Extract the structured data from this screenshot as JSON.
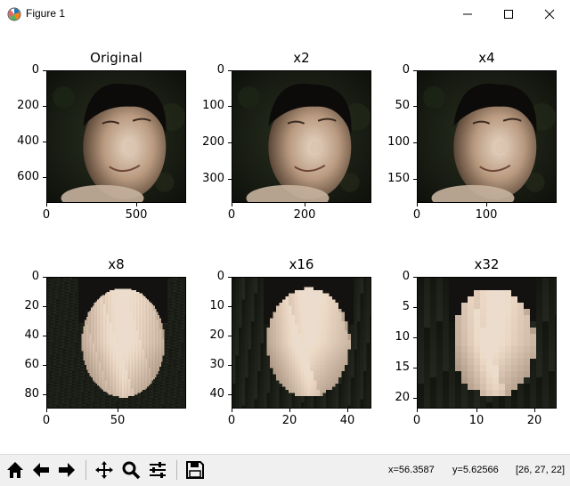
{
  "window": {
    "title": "Figure 1"
  },
  "panels": [
    {
      "title": "Original",
      "yticks": [
        "0",
        "200",
        "400",
        "600"
      ],
      "xticks": [
        "0",
        "500"
      ]
    },
    {
      "title": "x2",
      "yticks": [
        "0",
        "100",
        "200",
        "300"
      ],
      "xticks": [
        "0",
        "200"
      ]
    },
    {
      "title": "x4",
      "yticks": [
        "0",
        "50",
        "100",
        "150"
      ],
      "xticks": [
        "0",
        "100"
      ]
    },
    {
      "title": "x8",
      "yticks": [
        "0",
        "20",
        "40",
        "60",
        "80"
      ],
      "xticks": [
        "0",
        "50"
      ]
    },
    {
      "title": "x16",
      "yticks": [
        "0",
        "10",
        "20",
        "30",
        "40"
      ],
      "xticks": [
        "0",
        "20",
        "40"
      ]
    },
    {
      "title": "x32",
      "yticks": [
        "0",
        "5",
        "10",
        "15",
        "20"
      ],
      "xticks": [
        "0",
        "10",
        "20"
      ]
    }
  ],
  "toolbar": {
    "icons": [
      "home-icon",
      "back-icon",
      "forward-icon",
      "pan-icon",
      "zoom-icon",
      "configure-subplots-icon",
      "save-icon"
    ]
  },
  "status": {
    "x": "x=56.3587",
    "y": "y=5.62566",
    "rgb": "[26, 27, 22]"
  },
  "colors": {
    "background": "#ffffff",
    "toolbar": "#f0f0f0"
  }
}
